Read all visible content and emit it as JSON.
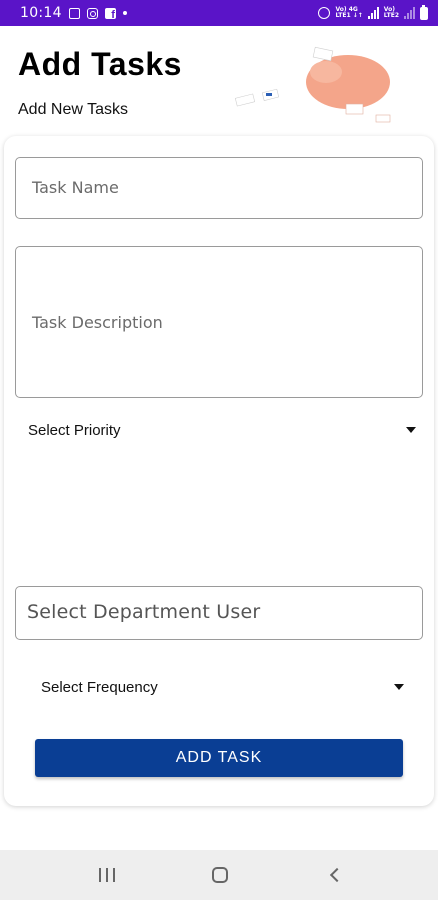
{
  "status_bar": {
    "time": "10:14",
    "network_label_1": "Vo) 4G\nLTE1 ↓↑",
    "network_label_2": "Vo)\nLTE2",
    "icons": [
      "image-icon",
      "instagram-icon",
      "facebook-icon",
      "dot-icon",
      "alarm-icon",
      "signal-icon",
      "battery-icon"
    ]
  },
  "header": {
    "title": "Add Tasks",
    "subtitle": "Add New Tasks"
  },
  "form": {
    "task_name_placeholder": "Task Name",
    "task_description_placeholder": "Task Description",
    "priority_label": "Select Priority",
    "department_user_placeholder": "Select Department User",
    "frequency_label": "Select Frequency",
    "submit_label": "ADD TASK"
  },
  "colors": {
    "status_bar": "#5a14c8",
    "button": "#0a3e94",
    "illustration_blob": "#f4a58a",
    "nav_bar": "#eeeeee"
  },
  "nav": {
    "icons": [
      "recents-icon",
      "home-icon",
      "back-icon"
    ]
  }
}
